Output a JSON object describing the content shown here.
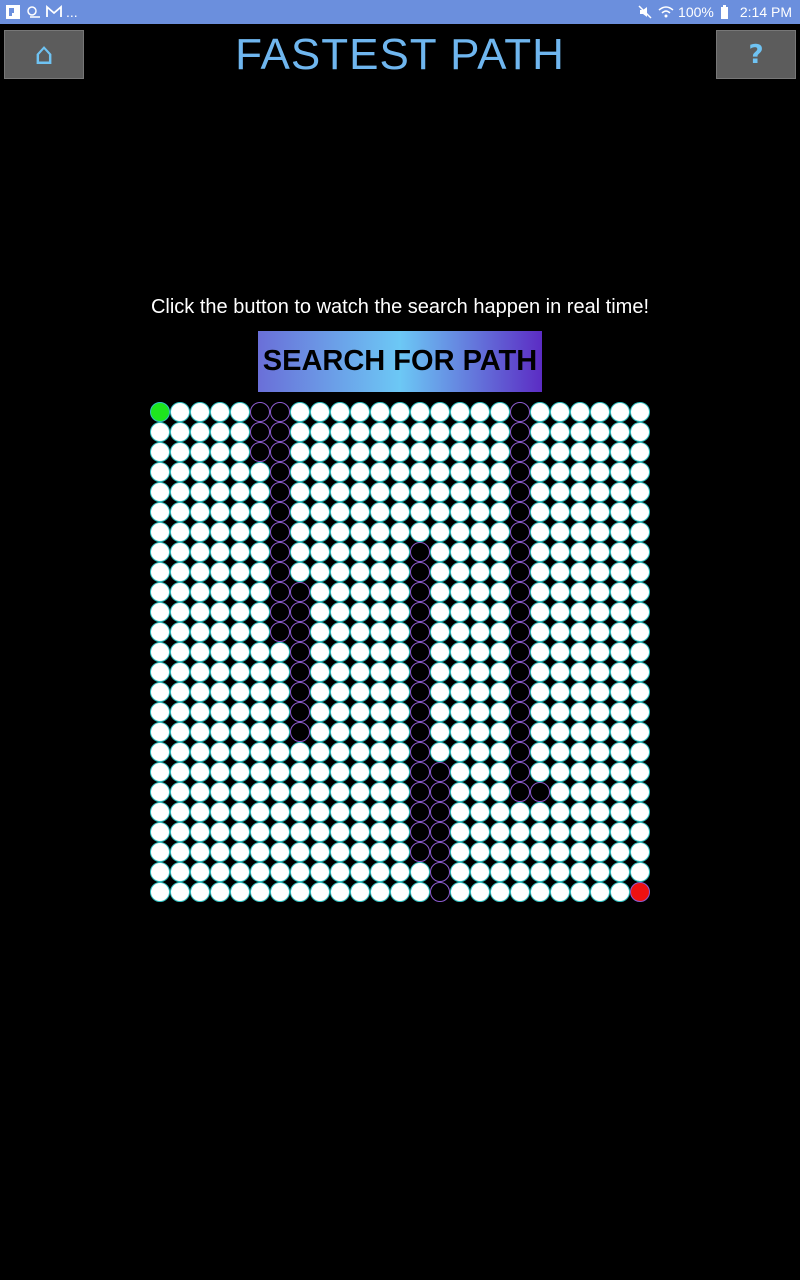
{
  "status_bar": {
    "left_icons": [
      "flipboard-icon",
      "weather-icon",
      "gmail-icon"
    ],
    "ellipsis": "...",
    "battery": "100%",
    "time": "2:14 PM",
    "right_icons": [
      "mute-icon",
      "wifi-icon",
      "battery-icon"
    ]
  },
  "header": {
    "home_glyph": "⌂",
    "title": "FASTEST PATH",
    "help_label": "?"
  },
  "main": {
    "instruction": "Click the button to watch the search happen in real time!",
    "search_button_label": "SEARCH FOR PATH"
  },
  "grid": {
    "rows": 25,
    "cols": 25,
    "start": [
      0,
      0
    ],
    "end": [
      24,
      24
    ],
    "walls": [
      [
        0,
        5
      ],
      [
        0,
        6
      ],
      [
        0,
        18
      ],
      [
        1,
        5
      ],
      [
        1,
        6
      ],
      [
        1,
        18
      ],
      [
        2,
        5
      ],
      [
        2,
        6
      ],
      [
        2,
        18
      ],
      [
        3,
        6
      ],
      [
        3,
        18
      ],
      [
        4,
        6
      ],
      [
        4,
        18
      ],
      [
        5,
        6
      ],
      [
        5,
        18
      ],
      [
        6,
        6
      ],
      [
        6,
        18
      ],
      [
        7,
        6
      ],
      [
        7,
        13
      ],
      [
        7,
        18
      ],
      [
        8,
        6
      ],
      [
        8,
        13
      ],
      [
        8,
        18
      ],
      [
        9,
        6
      ],
      [
        9,
        7
      ],
      [
        9,
        13
      ],
      [
        9,
        18
      ],
      [
        10,
        6
      ],
      [
        10,
        7
      ],
      [
        10,
        13
      ],
      [
        10,
        18
      ],
      [
        11,
        6
      ],
      [
        11,
        7
      ],
      [
        11,
        13
      ],
      [
        11,
        18
      ],
      [
        12,
        7
      ],
      [
        12,
        13
      ],
      [
        12,
        18
      ],
      [
        13,
        7
      ],
      [
        13,
        13
      ],
      [
        13,
        18
      ],
      [
        14,
        7
      ],
      [
        14,
        13
      ],
      [
        14,
        18
      ],
      [
        15,
        7
      ],
      [
        15,
        13
      ],
      [
        15,
        18
      ],
      [
        16,
        7
      ],
      [
        16,
        13
      ],
      [
        16,
        18
      ],
      [
        17,
        13
      ],
      [
        17,
        18
      ],
      [
        18,
        13
      ],
      [
        18,
        14
      ],
      [
        18,
        18
      ],
      [
        19,
        13
      ],
      [
        19,
        14
      ],
      [
        19,
        18
      ],
      [
        19,
        19
      ],
      [
        20,
        13
      ],
      [
        20,
        14
      ],
      [
        21,
        13
      ],
      [
        21,
        14
      ],
      [
        22,
        13
      ],
      [
        22,
        14
      ],
      [
        23,
        14
      ],
      [
        24,
        14
      ]
    ],
    "colors": {
      "open": "#ffffff",
      "wall": "#000000",
      "start": "#1ee61e",
      "end": "#ee1111",
      "open_border": "#32c3c3",
      "wall_border": "#8c5cd0"
    }
  }
}
